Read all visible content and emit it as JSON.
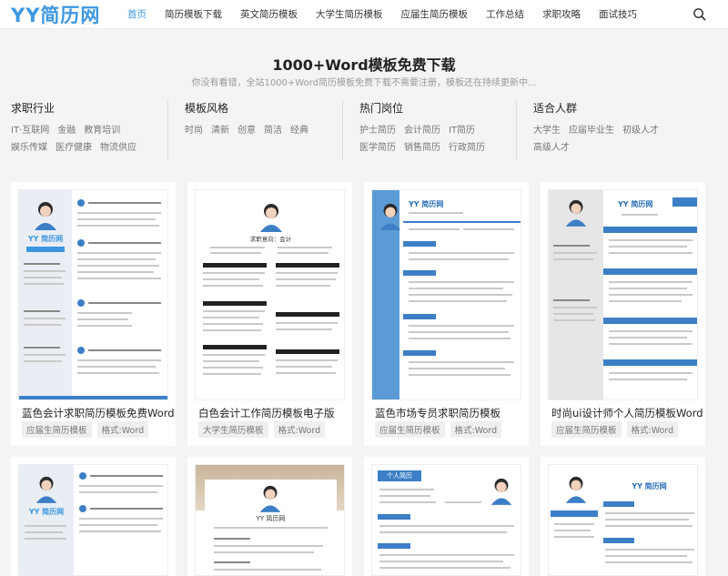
{
  "header": {
    "logo": "YY简历网",
    "nav": [
      "首页",
      "简历模板下载",
      "英文简历模板",
      "大学生简历模板",
      "应届生简历模板",
      "工作总结",
      "求职攻略",
      "面试技巧"
    ]
  },
  "hero": {
    "title": "1000+Word模板免费下载",
    "subtitle": "你没有看错，全站1000+Word简历模板免费下载不需要注册，模板还在持续更新中..."
  },
  "filters": [
    {
      "title": "求职行业",
      "tags": [
        "IT·互联网",
        "金融",
        "教育培训",
        "娱乐传媒",
        "医疗健康",
        "物流供应"
      ]
    },
    {
      "title": "模板风格",
      "tags": [
        "时尚",
        "清新",
        "创意",
        "简洁",
        "经典"
      ]
    },
    {
      "title": "热门岗位",
      "tags": [
        "护士简历",
        "会计简历",
        "IT简历",
        "医学简历",
        "销售简历",
        "行政简历"
      ]
    },
    {
      "title": "适合人群",
      "tags": [
        "大学生",
        "应届毕业生",
        "初级人才",
        "高级人才"
      ]
    }
  ],
  "cards": [
    {
      "title": "蓝色会计求职简历模板免费Word",
      "badges": [
        "应届生简历模板",
        "格式:Word"
      ],
      "thumb_text": "YY 简历网"
    },
    {
      "title": "白色会计工作简历模板电子版",
      "badges": [
        "大学生简历模板",
        "格式:Word"
      ],
      "thumb_text": "求职意向：会计"
    },
    {
      "title": "蓝色市场专员求职简历模板",
      "badges": [
        "应届生简历模板",
        "格式:Word"
      ],
      "thumb_text": "YY 简历网"
    },
    {
      "title": "时尚ui设计师个人简历模板Word",
      "badges": [
        "应届生简历模板",
        "格式:Word"
      ],
      "thumb_text": "YY 简历网"
    },
    {
      "thumb_text": "YY 简历网"
    },
    {
      "thumb_text": "YY 简历网"
    },
    {
      "thumb_text": "个人简历"
    },
    {
      "thumb_text": "YY 简历网"
    }
  ],
  "colors": {
    "accent": "#3d97e0"
  }
}
